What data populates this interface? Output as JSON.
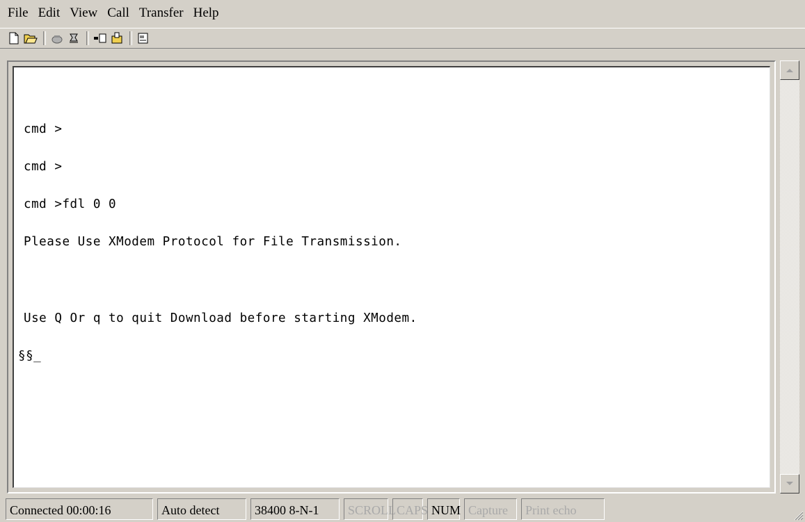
{
  "menu": [
    "File",
    "Edit",
    "View",
    "Call",
    "Transfer",
    "Help"
  ],
  "toolbar": {
    "icons": [
      "new-icon",
      "open-icon",
      "connect-icon",
      "disconnect-icon",
      "send-icon",
      "receive-icon",
      "properties-icon"
    ]
  },
  "terminal": {
    "lines": [
      "cmd >",
      "cmd >",
      "cmd >fdl 0 0",
      "Please Use XModem Protocol for File Transmission.",
      "",
      "Use Q Or q to quit Download before starting XModem."
    ],
    "cursor_line": "§§_"
  },
  "status": {
    "connected": "Connected 00:00:16",
    "detect": "Auto detect",
    "settings": "38400 8-N-1",
    "scroll": "SCROLL",
    "caps": "CAPS",
    "num": "NUM",
    "capture": "Capture",
    "print_echo": "Print echo"
  }
}
